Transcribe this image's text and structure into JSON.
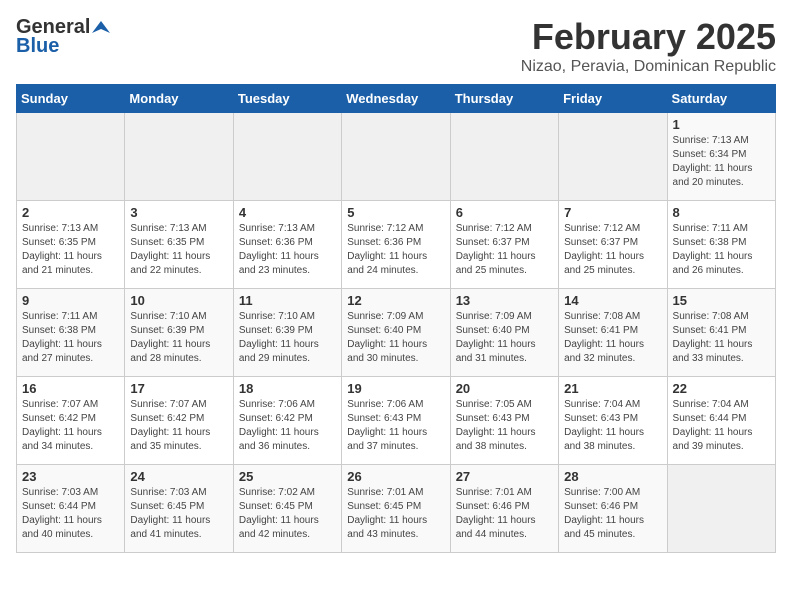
{
  "header": {
    "logo_general": "General",
    "logo_blue": "Blue",
    "title": "February 2025",
    "subtitle": "Nizao, Peravia, Dominican Republic"
  },
  "weekdays": [
    "Sunday",
    "Monday",
    "Tuesday",
    "Wednesday",
    "Thursday",
    "Friday",
    "Saturday"
  ],
  "weeks": [
    [
      {
        "day": "",
        "info": ""
      },
      {
        "day": "",
        "info": ""
      },
      {
        "day": "",
        "info": ""
      },
      {
        "day": "",
        "info": ""
      },
      {
        "day": "",
        "info": ""
      },
      {
        "day": "",
        "info": ""
      },
      {
        "day": "1",
        "info": "Sunrise: 7:13 AM\nSunset: 6:34 PM\nDaylight: 11 hours\nand 20 minutes."
      }
    ],
    [
      {
        "day": "2",
        "info": "Sunrise: 7:13 AM\nSunset: 6:35 PM\nDaylight: 11 hours\nand 21 minutes."
      },
      {
        "day": "3",
        "info": "Sunrise: 7:13 AM\nSunset: 6:35 PM\nDaylight: 11 hours\nand 22 minutes."
      },
      {
        "day": "4",
        "info": "Sunrise: 7:13 AM\nSunset: 6:36 PM\nDaylight: 11 hours\nand 23 minutes."
      },
      {
        "day": "5",
        "info": "Sunrise: 7:12 AM\nSunset: 6:36 PM\nDaylight: 11 hours\nand 24 minutes."
      },
      {
        "day": "6",
        "info": "Sunrise: 7:12 AM\nSunset: 6:37 PM\nDaylight: 11 hours\nand 25 minutes."
      },
      {
        "day": "7",
        "info": "Sunrise: 7:12 AM\nSunset: 6:37 PM\nDaylight: 11 hours\nand 25 minutes."
      },
      {
        "day": "8",
        "info": "Sunrise: 7:11 AM\nSunset: 6:38 PM\nDaylight: 11 hours\nand 26 minutes."
      }
    ],
    [
      {
        "day": "9",
        "info": "Sunrise: 7:11 AM\nSunset: 6:38 PM\nDaylight: 11 hours\nand 27 minutes."
      },
      {
        "day": "10",
        "info": "Sunrise: 7:10 AM\nSunset: 6:39 PM\nDaylight: 11 hours\nand 28 minutes."
      },
      {
        "day": "11",
        "info": "Sunrise: 7:10 AM\nSunset: 6:39 PM\nDaylight: 11 hours\nand 29 minutes."
      },
      {
        "day": "12",
        "info": "Sunrise: 7:09 AM\nSunset: 6:40 PM\nDaylight: 11 hours\nand 30 minutes."
      },
      {
        "day": "13",
        "info": "Sunrise: 7:09 AM\nSunset: 6:40 PM\nDaylight: 11 hours\nand 31 minutes."
      },
      {
        "day": "14",
        "info": "Sunrise: 7:08 AM\nSunset: 6:41 PM\nDaylight: 11 hours\nand 32 minutes."
      },
      {
        "day": "15",
        "info": "Sunrise: 7:08 AM\nSunset: 6:41 PM\nDaylight: 11 hours\nand 33 minutes."
      }
    ],
    [
      {
        "day": "16",
        "info": "Sunrise: 7:07 AM\nSunset: 6:42 PM\nDaylight: 11 hours\nand 34 minutes."
      },
      {
        "day": "17",
        "info": "Sunrise: 7:07 AM\nSunset: 6:42 PM\nDaylight: 11 hours\nand 35 minutes."
      },
      {
        "day": "18",
        "info": "Sunrise: 7:06 AM\nSunset: 6:42 PM\nDaylight: 11 hours\nand 36 minutes."
      },
      {
        "day": "19",
        "info": "Sunrise: 7:06 AM\nSunset: 6:43 PM\nDaylight: 11 hours\nand 37 minutes."
      },
      {
        "day": "20",
        "info": "Sunrise: 7:05 AM\nSunset: 6:43 PM\nDaylight: 11 hours\nand 38 minutes."
      },
      {
        "day": "21",
        "info": "Sunrise: 7:04 AM\nSunset: 6:43 PM\nDaylight: 11 hours\nand 38 minutes."
      },
      {
        "day": "22",
        "info": "Sunrise: 7:04 AM\nSunset: 6:44 PM\nDaylight: 11 hours\nand 39 minutes."
      }
    ],
    [
      {
        "day": "23",
        "info": "Sunrise: 7:03 AM\nSunset: 6:44 PM\nDaylight: 11 hours\nand 40 minutes."
      },
      {
        "day": "24",
        "info": "Sunrise: 7:03 AM\nSunset: 6:45 PM\nDaylight: 11 hours\nand 41 minutes."
      },
      {
        "day": "25",
        "info": "Sunrise: 7:02 AM\nSunset: 6:45 PM\nDaylight: 11 hours\nand 42 minutes."
      },
      {
        "day": "26",
        "info": "Sunrise: 7:01 AM\nSunset: 6:45 PM\nDaylight: 11 hours\nand 43 minutes."
      },
      {
        "day": "27",
        "info": "Sunrise: 7:01 AM\nSunset: 6:46 PM\nDaylight: 11 hours\nand 44 minutes."
      },
      {
        "day": "28",
        "info": "Sunrise: 7:00 AM\nSunset: 6:46 PM\nDaylight: 11 hours\nand 45 minutes."
      },
      {
        "day": "",
        "info": ""
      }
    ]
  ]
}
